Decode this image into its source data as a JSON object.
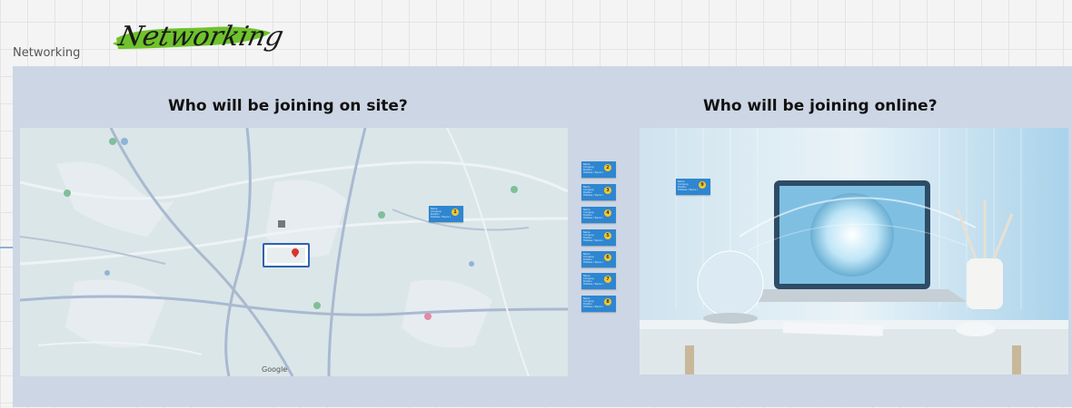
{
  "board": {
    "frame_label": "Networking",
    "logo_text": "Networking"
  },
  "sections": {
    "onsite_title": "Who will be joining on site?",
    "online_title": "Who will be joining online?"
  },
  "map": {
    "attribution": "Google"
  },
  "stickies": [
    {
      "name": "Name",
      "company": "Company",
      "role": "Position",
      "note": "Hobbies / Topics of interest",
      "badge": "1"
    },
    {
      "name": "Name",
      "company": "Company",
      "role": "Position",
      "note": "Hobbies / Topics of interest",
      "badge": "2"
    },
    {
      "name": "Name",
      "company": "Company",
      "role": "Position",
      "note": "Hobbies / Topics of interest",
      "badge": "3"
    },
    {
      "name": "Name",
      "company": "Company",
      "role": "Position",
      "note": "Hobbies / Topics of interest",
      "badge": "4"
    },
    {
      "name": "Name",
      "company": "Company",
      "role": "Position",
      "note": "Hobbies / Topics of interest",
      "badge": "5"
    },
    {
      "name": "Name",
      "company": "Company",
      "role": "Position",
      "note": "Hobbies / Topics of interest",
      "badge": "6"
    },
    {
      "name": "Name",
      "company": "Company",
      "role": "Position",
      "note": "Hobbies / Topics of interest",
      "badge": "7"
    },
    {
      "name": "Name",
      "company": "Company",
      "role": "Position",
      "note": "Hobbies / Topics of interest",
      "badge": "8"
    },
    {
      "name": "Name",
      "company": "Company",
      "role": "Position",
      "note": "Hobbies / Topics of interest",
      "badge": "9"
    }
  ],
  "colors": {
    "frame_bg": "#cdd6e4",
    "sticky_blue": "#2e86d1",
    "badge_yellow": "#f4c72a",
    "logo_green": "#6fc22c"
  }
}
